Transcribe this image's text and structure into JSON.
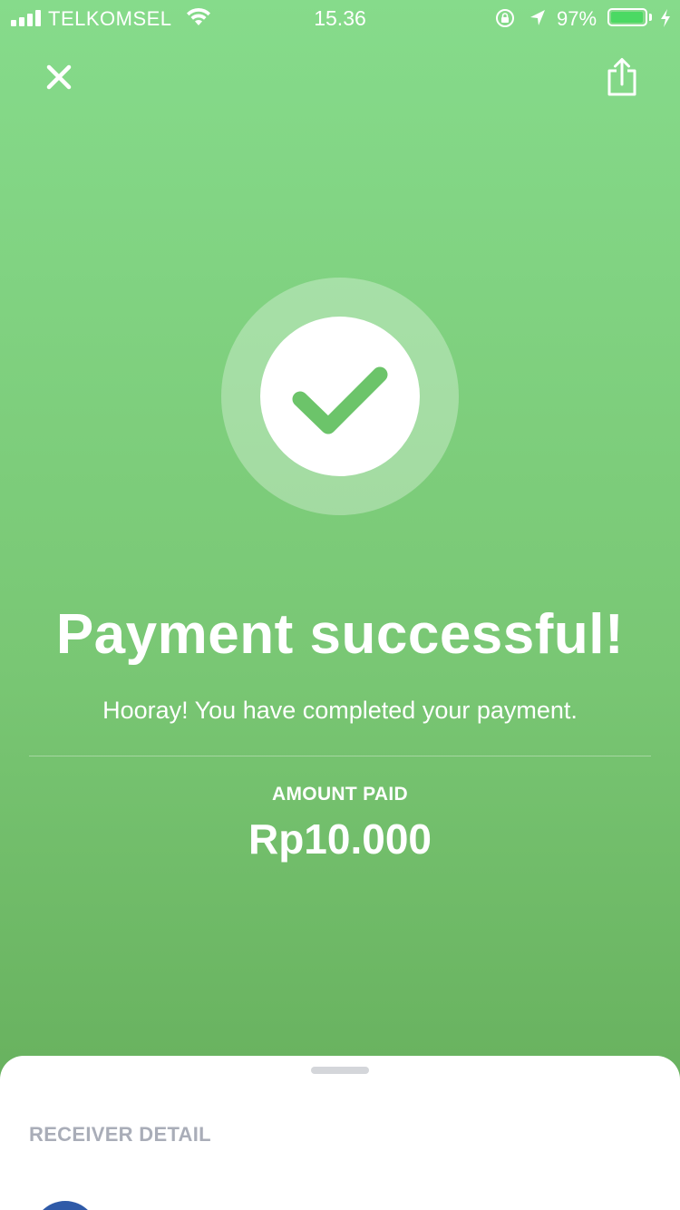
{
  "status_bar": {
    "carrier": "TELKOMSEL",
    "time": "15.36",
    "battery": "97%",
    "battery_level": 0.97,
    "icons": [
      "signal-icon",
      "wifi-icon",
      "rotation-lock-icon",
      "location-icon",
      "battery-icon",
      "charging-icon"
    ]
  },
  "header": {
    "close_icon": "close-icon",
    "share_icon": "share-icon"
  },
  "result": {
    "status_icon": "checkmark-icon",
    "title": "Payment successful!",
    "subtitle": "Hooray! You have completed your payment."
  },
  "amount": {
    "label": "AMOUNT PAID",
    "value": "Rp10.000"
  },
  "sheet": {
    "section_label": "RECEIVER DETAIL"
  },
  "colors": {
    "accent_green": "#79C774",
    "check_green": "#6CC46A",
    "avatar_blue": "#2F5AA8",
    "label_gray": "#A9ADB8"
  }
}
